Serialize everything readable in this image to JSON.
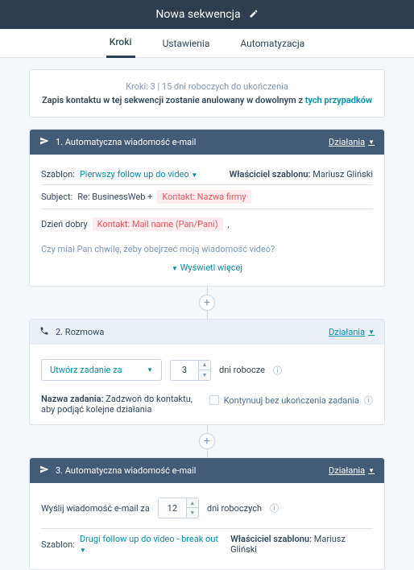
{
  "header": {
    "title": "Nowa sekwencja"
  },
  "tabs": {
    "t1": "Kroki",
    "t2": "Ustawienia",
    "t3": "Automatyzacja"
  },
  "info": {
    "line1": "Kroki: 3  |  15 dni roboczych do ukończenia",
    "line2a": "Zapis kontaktu w tej sekwencji zostanie anulowany w dowolnym z ",
    "line2b": "tych przypadków"
  },
  "actionsLabel": "Działania",
  "step1": {
    "title": "1. Automatyczna wiadomość e-mail",
    "templateLabel": "Szablon:",
    "templateName": "Pierwszy follow up do video",
    "ownerLabel": "Właściciel szablonu:",
    "ownerName": "Mariusz Gliński",
    "subjectLabel": "Subject:",
    "subjectText": "Re: BusinessWeb +",
    "subjectToken": "Kontakt: Nazwa firmy",
    "greeting": "Dzień dobry",
    "greetToken": "Kontakt: Mail name (Pan/Pani)",
    "comma": ",",
    "preview": "Czy miał Pan chwilę, żeby obejrzeć moją wiadomość video?",
    "showMore": "Wyświetl więcej"
  },
  "step2": {
    "title": "2. Rozmowa",
    "createLabel": "Utwórz zadanie za",
    "days": "3",
    "daysUnit": "dni robocze",
    "taskNameLabel": "Nazwa zadania:",
    "taskNameValue": "Zadzwoń do kontaktu, aby podjąć kolejne działania",
    "continueLabel": "Kontynuuj bez ukończenia zadania"
  },
  "step3": {
    "title": "3. Automatyczna wiadomość e-mail",
    "sendLabel": "Wyślij wiadomość e-mail za",
    "days": "12",
    "daysUnit": "dni roboczych",
    "templateLabel": "Szablon:",
    "templateName": "Drugi follow up do video - break out",
    "ownerLabel": "Właściciel szablonu:",
    "ownerName": "Mariusz Gliński"
  }
}
